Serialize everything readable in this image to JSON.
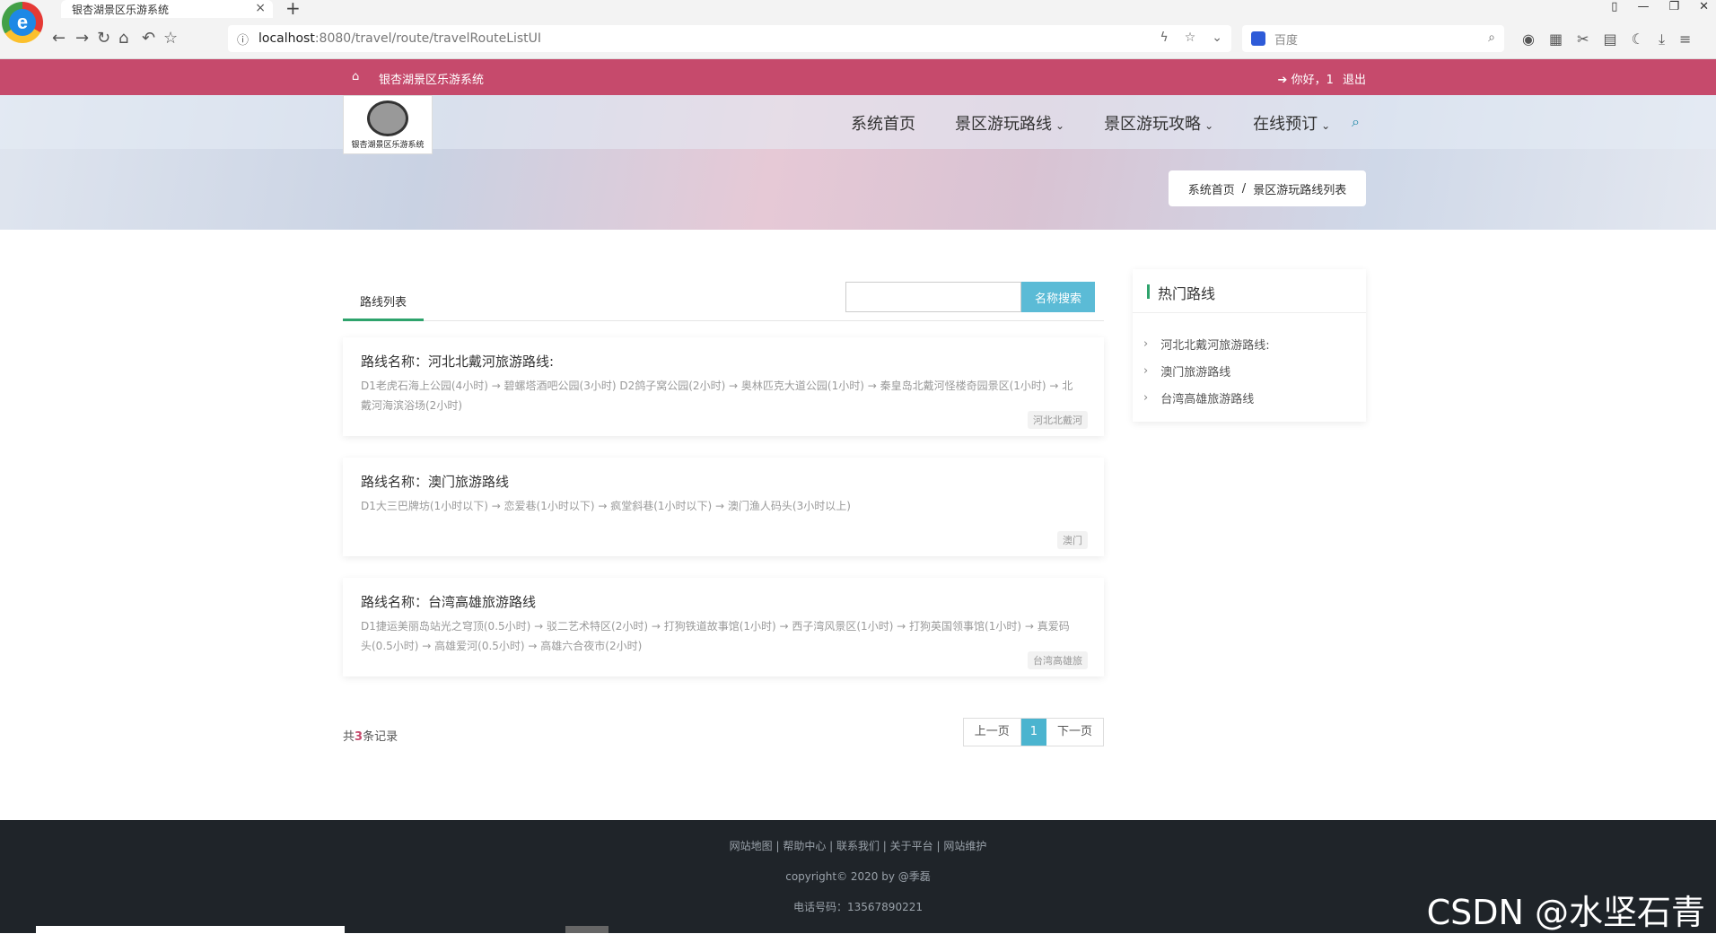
{
  "browser": {
    "tab_title": "银杏湖景区乐游系统",
    "url_host": "localhost",
    "url_path": ":8080/travel/route/travelRouteListUI",
    "search_engine": "百度"
  },
  "topbar": {
    "site_name": "银杏湖景区乐游系统",
    "greeting": "你好，1",
    "logout": "退出"
  },
  "logo": {
    "text": "银杏湖景区乐游系统"
  },
  "nav": {
    "items": [
      {
        "label": "系统首页"
      },
      {
        "label": "景区游玩路线"
      },
      {
        "label": "景区游玩攻略"
      },
      {
        "label": "在线预订"
      }
    ]
  },
  "breadcrumb": {
    "home": "系统首页",
    "sep": "/",
    "current": "景区游玩路线列表"
  },
  "list": {
    "tab_label": "路线列表",
    "search_button": "名称搜索",
    "search_placeholder": "",
    "routes": [
      {
        "name": "路线名称：河北北戴河旅游路线:",
        "desc": "D1老虎石海上公园(4小时) → 碧螺塔酒吧公园(3小时) D2鸽子窝公园(2小时) → 奥林匹克大道公园(1小时) → 秦皇岛北戴河怪楼奇园景区(1小时) → 北戴河海滨浴场(2小时)",
        "tag": "河北北戴河"
      },
      {
        "name": "路线名称：澳门旅游路线",
        "desc": "D1大三巴牌坊(1小时以下) → 恋爱巷(1小时以下) → 疯堂斜巷(1小时以下) → 澳门渔人码头(3小时以上)",
        "tag": "澳门"
      },
      {
        "name": "路线名称：台湾高雄旅游路线",
        "desc": "D1捷运美丽岛站光之穹顶(0.5小时) → 驳二艺术特区(2小时) → 打狗铁道故事馆(1小时) → 西子湾风景区(1小时) → 打狗英国领事馆(1小时) → 真爱码头(0.5小时) → 高雄爱河(0.5小时) → 高雄六合夜市(2小时)",
        "tag": "台湾高雄旅"
      }
    ],
    "count_prefix": "共",
    "count": "3",
    "count_suffix": "条记录",
    "pager": {
      "prev": "上一页",
      "current": "1",
      "next": "下一页"
    }
  },
  "sidebar": {
    "title": "热门路线",
    "items": [
      {
        "label": "河北北戴河旅游路线:"
      },
      {
        "label": "澳门旅游路线"
      },
      {
        "label": "台湾高雄旅游路线"
      }
    ]
  },
  "footer": {
    "links": "网站地图 | 帮助中心 | 联系我们 | 关于平台 | 网站维护",
    "copyright": "copyright© 2020 by @季磊",
    "phone": "电话号码：13567890221"
  },
  "watermark": "CSDN @水坚石青"
}
